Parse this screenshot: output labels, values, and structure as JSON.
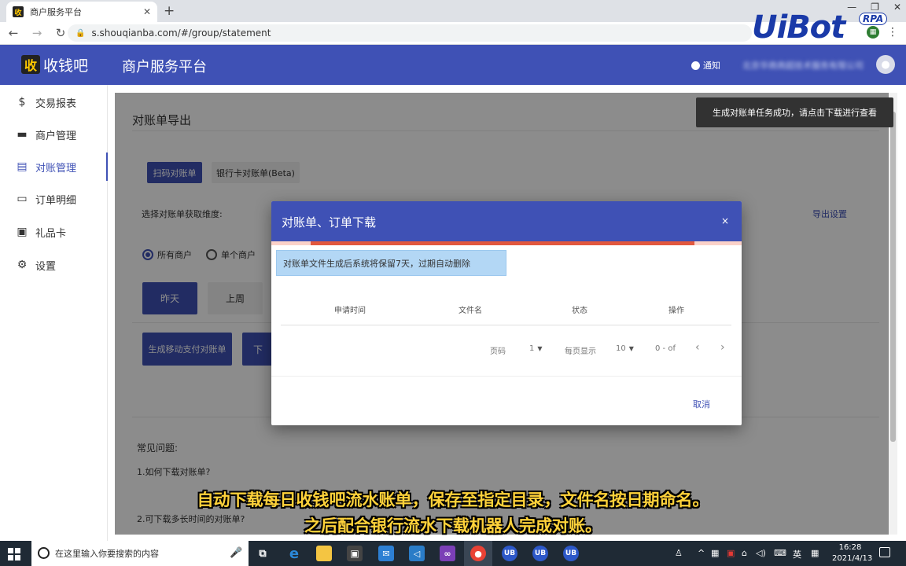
{
  "browser": {
    "tab_title": "商户服务平台",
    "tab_favicon": "收",
    "url": "s.shouqianba.com/#/group/statement"
  },
  "watermark": {
    "brand": "UiBot",
    "badge": "RPA"
  },
  "header": {
    "logo_char": "收",
    "logo_text": "收钱吧",
    "title": "商户服务平台",
    "notify_label": "通知",
    "merchant_name": "北京华商商超技术服务有限公司",
    "color": "#3f51b5"
  },
  "sidebar": {
    "items": [
      {
        "label": "交易报表",
        "icon": "dollar-icon"
      },
      {
        "label": "商户管理",
        "icon": "store-icon"
      },
      {
        "label": "对账管理",
        "icon": "ledger-icon",
        "active": true
      },
      {
        "label": "订单明细",
        "icon": "card-icon"
      },
      {
        "label": "礼品卡",
        "icon": "gift-icon"
      },
      {
        "label": "设置",
        "icon": "gear-icon"
      }
    ]
  },
  "page": {
    "section_title": "对账单导出",
    "tabs": [
      "扫码对账单",
      "银行卡对账单(Beta)"
    ],
    "dimension_label": "选择对账单获取维度:",
    "export_settings": "导出设置",
    "radios": [
      "所有商户",
      "单个商户"
    ],
    "range_buttons": [
      "昨天",
      "上周"
    ],
    "generate_button": "生成移动支付对账单",
    "download_button_partial": "下",
    "faq_title": "常见问题:",
    "faq_items": [
      "1.如何下载对账单?",
      "2.可下载多长时间的对账单?"
    ]
  },
  "snackbar": "生成对账单任务成功，请点击下载进行查看",
  "modal": {
    "title": "对账单、订单下载",
    "close": "×",
    "info": "对账单文件生成后系统将保留7天，过期自动删除",
    "columns": [
      "申请时间",
      "文件名",
      "状态",
      "操作"
    ],
    "pager": {
      "page_label": "页码",
      "page_value": "1",
      "per_page_label": "每页显示",
      "per_page_value": "10",
      "range": "0 - of"
    },
    "cancel": "取消"
  },
  "subtitles": [
    "自动下载每日收钱吧流水账单，保存至指定目录，文件名按日期命名。",
    "之后配合银行流水下载机器人完成对账。"
  ],
  "taskbar": {
    "search_placeholder": "在这里输入你要搜索的内容",
    "ime": "英",
    "time": "16:28",
    "date": "2021/4/13"
  }
}
